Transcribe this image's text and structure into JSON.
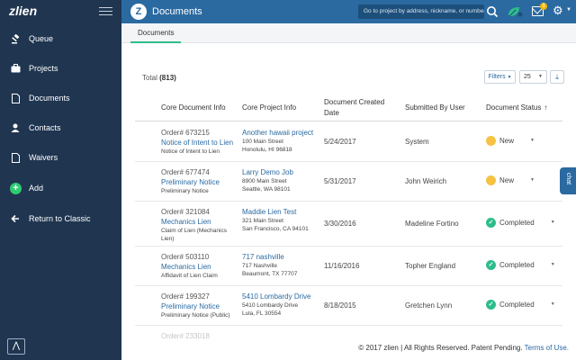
{
  "sidebar": {
    "logo": "zlien",
    "items": [
      {
        "label": "Queue",
        "icon": "gavel-icon"
      },
      {
        "label": "Projects",
        "icon": "briefcase-icon"
      },
      {
        "label": "Documents",
        "icon": "document-icon"
      },
      {
        "label": "Contacts",
        "icon": "user-icon"
      },
      {
        "label": "Waivers",
        "icon": "document-icon"
      },
      {
        "label": "Add",
        "icon": "plus-icon"
      },
      {
        "label": "Return to Classic",
        "icon": "arrow-left-icon"
      }
    ],
    "add_glyph": "+"
  },
  "topbar": {
    "title": "Documents",
    "badge_letter": "Z",
    "search_placeholder": "Go to project by address, nickname, or number",
    "notification_count": "1"
  },
  "tabs": [
    {
      "label": "Documents"
    }
  ],
  "table_controls": {
    "total_label": "Total",
    "total_count": "(813)",
    "filters_label": "Filters",
    "page_size": "25"
  },
  "table": {
    "columns": [
      "Core Document Info",
      "Core Project Info",
      "Document Created Date",
      "Submitted By User",
      "Document Status"
    ],
    "rows": [
      {
        "order": "Order# 673215",
        "doc_title": "Notice of Intent to Lien",
        "doc_sub": "Notice of Intent to Lien",
        "project": "Another hawaii project",
        "address1": "100 Main Street",
        "address2": "Honolulu, HI 96818",
        "date": "5/24/2017",
        "user": "System",
        "status": "New"
      },
      {
        "order": "Order# 677474",
        "doc_title": "Preliminary Notice",
        "doc_sub": "Preliminary Notice",
        "project": "Larry Demo Job",
        "address1": "8900 Main Street",
        "address2": "Seattle, WA 98101",
        "date": "5/31/2017",
        "user": "John Weirich",
        "status": "New"
      },
      {
        "order": "Order# 321084",
        "doc_title": "Mechanics Lien",
        "doc_sub": "Claim of Lien (Mechanics Lien)",
        "project": "Maddie Lien Test",
        "address1": "321 Main Street",
        "address2": "San Francisco, CA 94101",
        "date": "3/30/2016",
        "user": "Madeline Fortino",
        "status": "Completed"
      },
      {
        "order": "Order# 503110",
        "doc_title": "Mechanics Lien",
        "doc_sub": "Affidavit of Lien Claim",
        "project": "717 nashville",
        "address1": "717 Nashville",
        "address2": "Beaumont, TX 77707",
        "date": "11/16/2016",
        "user": "Topher England",
        "status": "Completed"
      },
      {
        "order": "Order# 199327",
        "doc_title": "Preliminary Notice",
        "doc_sub": "Preliminary Notice (Public)",
        "project": "5410 Lombardy Drive",
        "address1": "5410 Lombardy Drive",
        "address2": "Lula, FL 30554",
        "date": "8/18/2015",
        "user": "Gretchen Lynn",
        "status": "Completed"
      },
      {
        "order": "Order# 233018",
        "doc_title": "",
        "doc_sub": "",
        "project": "",
        "address1": "",
        "address2": "",
        "date": "",
        "user": "",
        "status": ""
      }
    ]
  },
  "footer": {
    "text": "© 2017 zlien | All Rights Reserved. Patent Pending.",
    "link": "Terms of Use."
  },
  "chat": {
    "label": "chat"
  },
  "colors": {
    "sidebar_bg": "#1f3550",
    "topbar_bg": "#2a6aa1",
    "link": "#2a6aa1",
    "status_new": "#f5c242",
    "status_completed": "#2ebd8a"
  }
}
